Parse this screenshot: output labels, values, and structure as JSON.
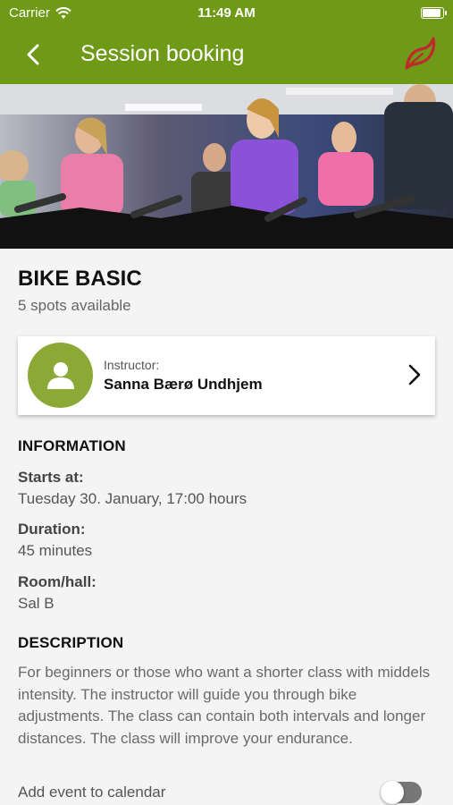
{
  "status_bar": {
    "carrier": "Carrier",
    "time": "11:49 AM"
  },
  "navbar": {
    "title": "Session booking"
  },
  "session": {
    "title": "BIKE BASIC",
    "spots": "5 spots available"
  },
  "instructor": {
    "caption": "Instructor:",
    "name": "Sanna Bærø Undhjem"
  },
  "information": {
    "heading": "INFORMATION",
    "starts_label": "Starts at:",
    "starts_value": "Tuesday 30. January, 17:00 hours",
    "duration_label": "Duration:",
    "duration_value": "45 minutes",
    "room_label": "Room/hall:",
    "room_value": "Sal B"
  },
  "description": {
    "heading": "DESCRIPTION",
    "text": "For beginners or those who want a shorter class with middels intensity. The instructor will guide you through bike adjustments. The class can contain both intervals and longer distances.  The class will improve your endurance."
  },
  "calendar": {
    "label": "Add event to calendar",
    "enabled": false
  },
  "colors": {
    "accent": "#6e9a17",
    "avatar_bg": "#8aaa35",
    "brand_logo": "#c0282d"
  }
}
